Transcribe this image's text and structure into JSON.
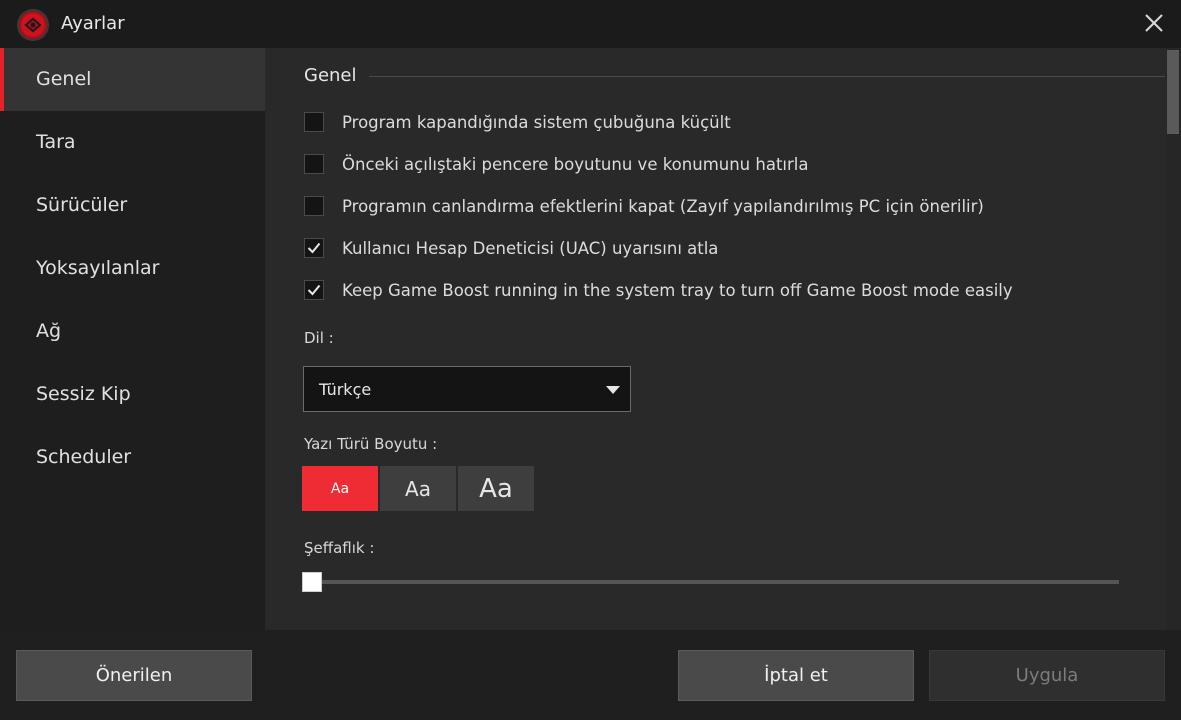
{
  "window": {
    "title": "Ayarlar",
    "logo_icon": "iobit-logo-icon",
    "close_icon": "close-icon"
  },
  "sidebar": {
    "items": [
      {
        "label": "Genel",
        "active": true
      },
      {
        "label": "Tara"
      },
      {
        "label": "Sürücüler"
      },
      {
        "label": "Yoksayılanlar"
      },
      {
        "label": "Ağ"
      },
      {
        "label": "Sessiz Kip"
      },
      {
        "label": "Scheduler"
      }
    ]
  },
  "general": {
    "section_title": "Genel",
    "options": [
      {
        "label": "Program kapandığında sistem çubuğuna küçült",
        "checked": false
      },
      {
        "label": "Önceki açılıştaki pencere boyutunu ve konumunu hatırla",
        "checked": false
      },
      {
        "label": "Programın canlandırma efektlerini kapat (Zayıf yapılandırılmış PC için önerilir)",
        "checked": false
      },
      {
        "label": "Kullanıcı Hesap Deneticisi (UAC) uyarısını atla",
        "checked": true
      },
      {
        "label": "Keep Game Boost running in the system tray to turn off Game Boost mode easily",
        "checked": true
      }
    ],
    "language": {
      "label": "Dil :",
      "selected": "Türkçe"
    },
    "font_size": {
      "label": "Yazı Türü Boyutu :",
      "options": [
        "Aa",
        "Aa",
        "Aa"
      ],
      "selected_index": 0
    },
    "transparency": {
      "label": "Şeffaflık :",
      "value": 0
    }
  },
  "footer": {
    "recommended_label": "Önerilen",
    "cancel_label": "İptal et",
    "apply_label": "Uygula",
    "apply_enabled": false
  },
  "colors": {
    "accent": "#ef2b34",
    "background": "#292929",
    "sidebar": "#1e1e1e"
  }
}
